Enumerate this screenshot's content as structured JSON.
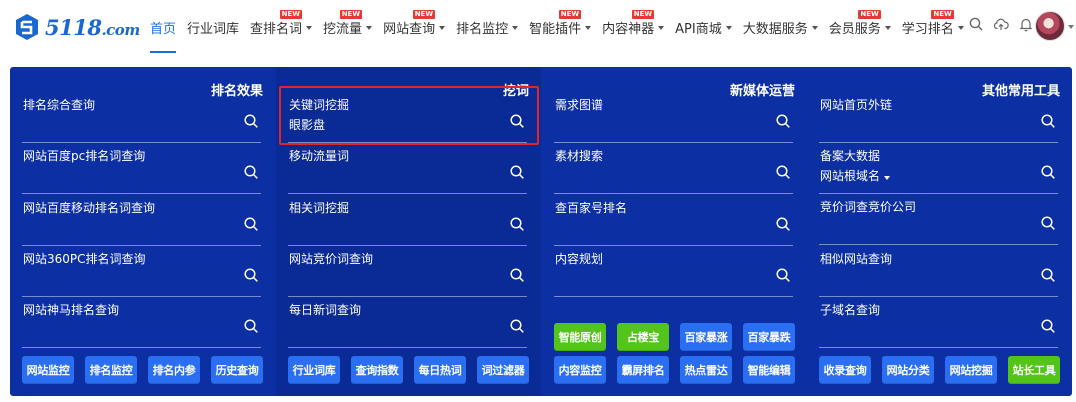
{
  "brand": {
    "logo_text": "5118",
    "logo_domain": ".com",
    "brand_color": "#1a67d2"
  },
  "nav": {
    "items": [
      {
        "label": "首页",
        "active": true,
        "dropdown": false,
        "badge": ""
      },
      {
        "label": "行业词库",
        "active": false,
        "dropdown": false,
        "badge": ""
      },
      {
        "label": "查排名词",
        "active": false,
        "dropdown": true,
        "badge": "NEW"
      },
      {
        "label": "挖流量",
        "active": false,
        "dropdown": true,
        "badge": "NEW"
      },
      {
        "label": "网站查询",
        "active": false,
        "dropdown": true,
        "badge": "NEW"
      },
      {
        "label": "排名监控",
        "active": false,
        "dropdown": true,
        "badge": ""
      },
      {
        "label": "智能插件",
        "active": false,
        "dropdown": true,
        "badge": "NEW"
      },
      {
        "label": "内容神器",
        "active": false,
        "dropdown": true,
        "badge": "NEW"
      },
      {
        "label": "API商城",
        "active": false,
        "dropdown": true,
        "badge": ""
      },
      {
        "label": "大数据服务",
        "active": false,
        "dropdown": true,
        "badge": ""
      },
      {
        "label": "会员服务",
        "active": false,
        "dropdown": true,
        "badge": "NEW"
      },
      {
        "label": "学习排名",
        "active": false,
        "dropdown": true,
        "badge": "NEW"
      }
    ],
    "icons": [
      "search-icon",
      "cloud-upload-icon",
      "bell-icon"
    ],
    "accent_color": "#1a6fde",
    "badge_color": "#e53935"
  },
  "panel": {
    "background": "#0c2fa3",
    "columns": [
      {
        "title": "排名效果",
        "fields": [
          {
            "label": "排名综合查询",
            "value": ""
          },
          {
            "label": "网站百度pc排名词查询",
            "value": ""
          },
          {
            "label": "网站百度移动排名词查询",
            "value": ""
          },
          {
            "label": "网站360PC排名词查询",
            "value": ""
          },
          {
            "label": "网站神马排名查询",
            "value": ""
          }
        ],
        "buttons": [
          {
            "label": "网站监控",
            "style": "blue"
          },
          {
            "label": "排名监控",
            "style": "blue"
          },
          {
            "label": "排名内参",
            "style": "blue"
          },
          {
            "label": "历史查询",
            "style": "blue"
          }
        ]
      },
      {
        "title": "挖词",
        "fields": [
          {
            "label": "关键词挖掘",
            "value": "眼影盘"
          },
          {
            "label": "移动流量词",
            "value": ""
          },
          {
            "label": "相关词挖掘",
            "value": ""
          },
          {
            "label": "网站竞价词查询",
            "value": ""
          },
          {
            "label": "每日新词查询",
            "value": ""
          }
        ],
        "buttons": [
          {
            "label": "行业词库",
            "style": "blue"
          },
          {
            "label": "查询指数",
            "style": "blue"
          },
          {
            "label": "每日热词",
            "style": "blue"
          },
          {
            "label": "词过滤器",
            "style": "blue"
          }
        ]
      },
      {
        "title": "新媒体运营",
        "fields": [
          {
            "label": "需求图谱",
            "value": ""
          },
          {
            "label": "素材搜索",
            "value": ""
          },
          {
            "label": "查百家号排名",
            "value": ""
          },
          {
            "label": "内容规划",
            "value": ""
          }
        ],
        "buttons_row1": [
          {
            "label": "智能原创",
            "style": "green"
          },
          {
            "label": "占楼宝",
            "style": "green"
          },
          {
            "label": "百家暴涨",
            "style": "blue"
          },
          {
            "label": "百家暴跌",
            "style": "blue"
          }
        ],
        "buttons": [
          {
            "label": "内容监控",
            "style": "blue"
          },
          {
            "label": "霸屏排名",
            "style": "blue"
          },
          {
            "label": "热点雷达",
            "style": "blue"
          },
          {
            "label": "智能编辑",
            "style": "blue"
          }
        ]
      },
      {
        "title": "其他常用工具",
        "fields": [
          {
            "label": "网站首页外链",
            "value": ""
          },
          {
            "label": "备案大数据",
            "value": "网站根域名"
          },
          {
            "label": "竞价词查竞价公司",
            "value": ""
          },
          {
            "label": "相似网站查询",
            "value": ""
          },
          {
            "label": "子域名查询",
            "value": ""
          }
        ],
        "buttons": [
          {
            "label": "收录查询",
            "style": "blue"
          },
          {
            "label": "网站分类",
            "style": "blue"
          },
          {
            "label": "网站挖掘",
            "style": "blue"
          },
          {
            "label": "站长工具",
            "style": "green"
          }
        ]
      }
    ]
  }
}
